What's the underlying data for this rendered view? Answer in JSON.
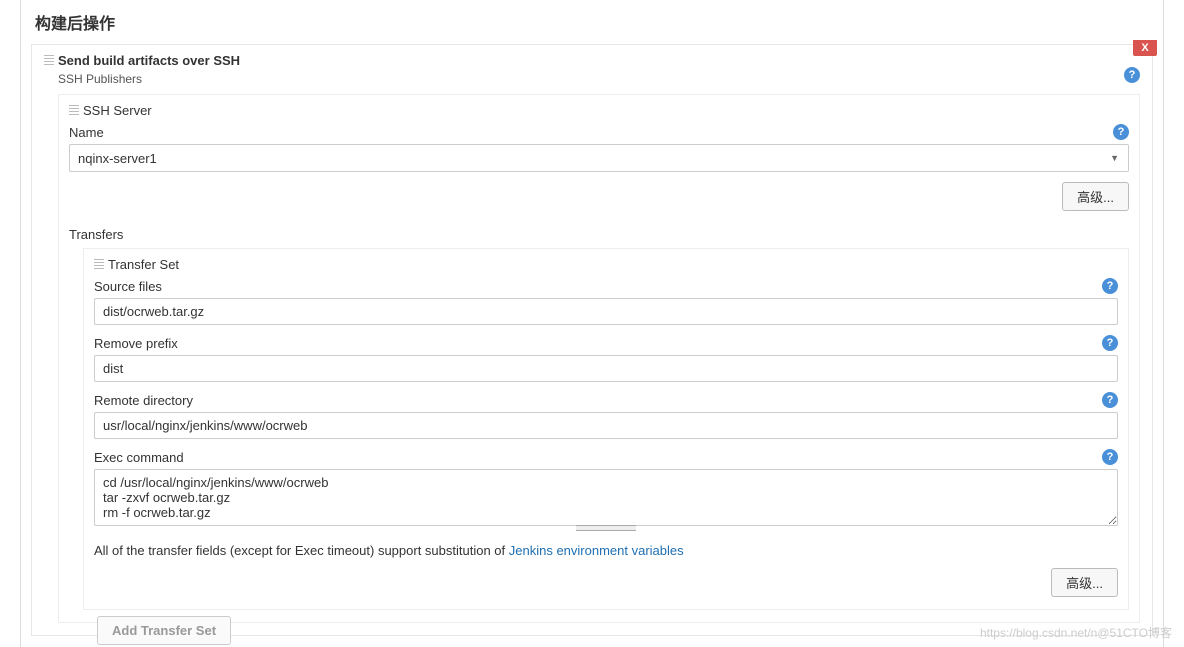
{
  "section_title": "构建后操作",
  "close_label": "X",
  "help_char": "?",
  "step": {
    "header": "Send build artifacts over SSH",
    "publishers_label": "SSH Publishers",
    "server": {
      "header": "SSH Server",
      "name_label": "Name",
      "name_value": "nqinx-server1",
      "advanced_label": "高级...",
      "transfers_label": "Transfers",
      "transfer_set": {
        "header": "Transfer Set",
        "source_label": "Source files",
        "source_value": "dist/ocrweb.tar.gz",
        "remove_prefix_label": "Remove prefix",
        "remove_prefix_value": "dist",
        "remote_dir_label": "Remote directory",
        "remote_dir_value": "usr/local/nginx/jenkins/www/ocrweb",
        "exec_label": "Exec command",
        "exec_value": "cd /usr/local/nginx/jenkins/www/ocrweb\ntar -zxvf ocrweb.tar.gz\nrm -f ocrweb.tar.gz",
        "hint_prefix": "All of the transfer fields (except for Exec timeout) support substitution of ",
        "hint_link": "Jenkins environment variables",
        "advanced_label": "高级..."
      }
    }
  },
  "add_transfer_label": "Add Transfer Set",
  "watermark": "https://blog.csdn.net/n@51CTO博客"
}
